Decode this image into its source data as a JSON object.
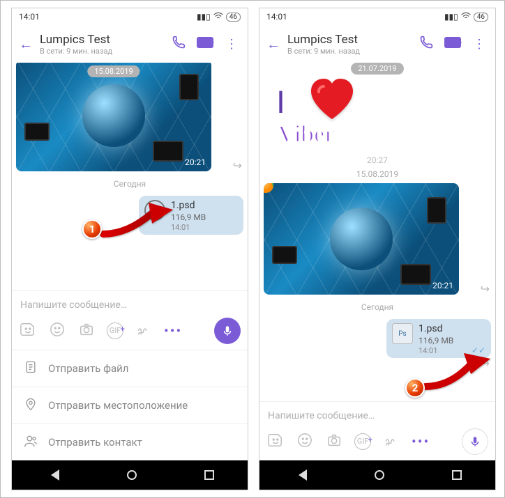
{
  "accent": "#7b5cd6",
  "status": {
    "time": "14:01",
    "battery": "46"
  },
  "header": {
    "contact_name": "Lumpics Test",
    "status_line": "В сети: 9 мин. назад"
  },
  "left": {
    "image_date_pill": "15.08.2019",
    "image_time": "20:21",
    "today_label": "Сегодня",
    "file": {
      "name": "1.psd",
      "size": "116,9 MB",
      "time": "14:01",
      "icon": "cancel"
    },
    "composer_placeholder": "Напишите сообщение…",
    "attach_menu": {
      "send_file": "Отправить файл",
      "send_location": "Отправить местоположение",
      "send_contact": "Отправить контакт"
    }
  },
  "right": {
    "top_date_pill": "21.07.2019",
    "sticker_text_i": "I",
    "sticker_text_brand": "Viber",
    "sticker_time": "20:27",
    "mid_date": "15.08.2019",
    "image_time": "20:21",
    "today_label": "Сегодня",
    "file": {
      "name": "1.psd",
      "size": "116,9 MB",
      "time": "14:01",
      "icon": "Ps"
    },
    "composer_placeholder": "Напишите сообщение…"
  },
  "callouts": {
    "one": "1",
    "two": "2"
  }
}
